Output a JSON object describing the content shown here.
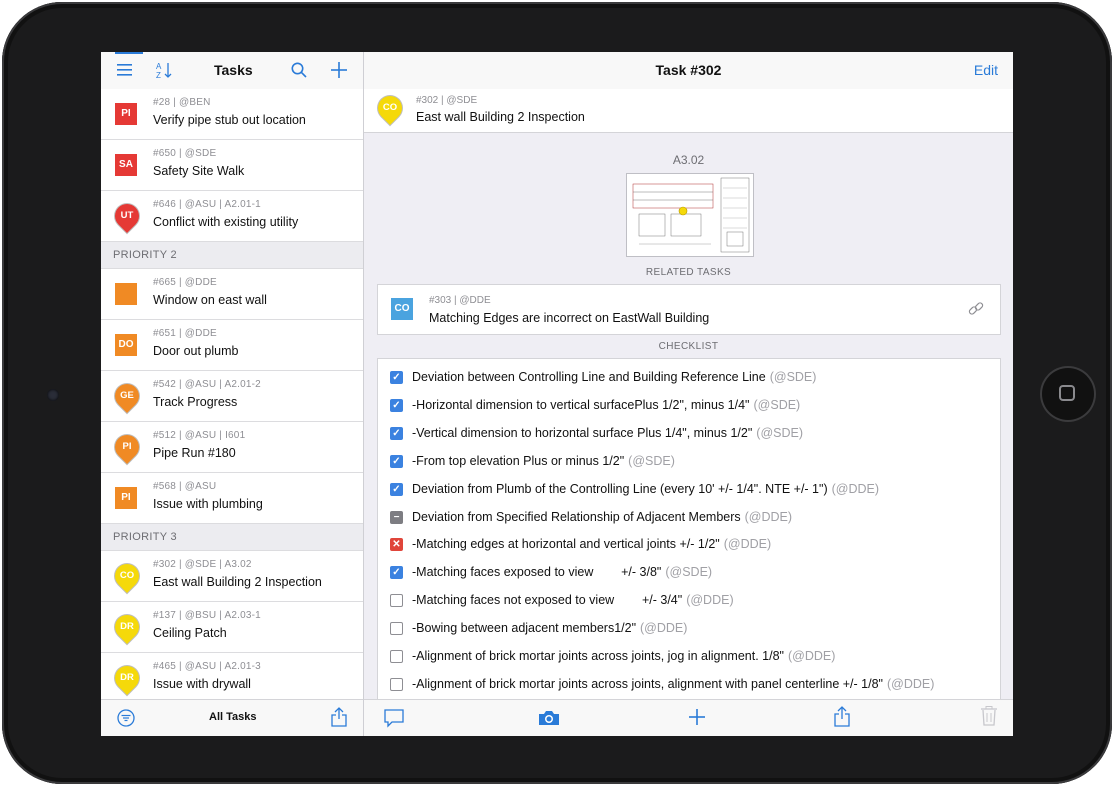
{
  "left_panel": {
    "title": "Tasks",
    "rows": [
      {
        "meta": "#28 | @BEN",
        "title": "Verify pipe stub out location",
        "code": "PI",
        "shape": "square",
        "color": "#e53935",
        "text_color": "#ffffff"
      },
      {
        "meta": "#650 | @SDE",
        "title": "Safety Site Walk",
        "code": "SA",
        "shape": "square",
        "color": "#e53935",
        "text_color": "#ffffff"
      },
      {
        "meta": "#646 | @ASU | A2.01-1",
        "title": "Conflict with existing utility",
        "code": "UT",
        "shape": "pin",
        "color": "#e53935",
        "text_color": "#ffffff"
      }
    ],
    "section_2": "PRIORITY 2",
    "rows_p2": [
      {
        "meta": "#665 | @DDE",
        "title": "Window on east wall",
        "code": "",
        "shape": "square",
        "color": "#f08a24",
        "text_color": "#ffffff"
      },
      {
        "meta": "#651 | @DDE",
        "title": "Door out plumb",
        "code": "DO",
        "shape": "square",
        "color": "#f08a24",
        "text_color": "#ffffff"
      },
      {
        "meta": "#542 | @ASU | A2.01-2",
        "title": "Track Progress",
        "code": "GE",
        "shape": "pin",
        "color": "#f08a24",
        "text_color": "#ffffff"
      },
      {
        "meta": "#512 | @ASU | I601",
        "title": "Pipe Run #180",
        "code": "PI",
        "shape": "pin",
        "color": "#f08a24",
        "text_color": "#ffffff"
      },
      {
        "meta": "#568 | @ASU",
        "title": "Issue with plumbing",
        "code": "PI",
        "shape": "square",
        "color": "#f08a24",
        "text_color": "#ffffff"
      }
    ],
    "section_3": "PRIORITY 3",
    "rows_p3": [
      {
        "meta": "#302 | @SDE | A3.02",
        "title": "East wall Building 2 Inspection",
        "code": "CO",
        "shape": "pin",
        "color": "#f5d90a",
        "text_color": "#ffffff"
      },
      {
        "meta": "#137 | @BSU | A2.03-1",
        "title": "Ceiling Patch",
        "code": "DR",
        "shape": "pin",
        "color": "#f5d90a",
        "text_color": "#ffffff"
      },
      {
        "meta": "#465 | @ASU | A2.01-3",
        "title": "Issue with drywall",
        "code": "DR",
        "shape": "pin",
        "color": "#f5d90a",
        "text_color": "#ffffff"
      }
    ],
    "bottom_label": "All Tasks"
  },
  "detail": {
    "title": "Task #302",
    "edit_label": "Edit",
    "task_code": "CO",
    "task_meta": "#302 | @SDE",
    "task_title": "East wall Building 2 Inspection",
    "sheet_label": "A3.02",
    "related_heading": "RELATED TASKS",
    "related": {
      "code": "CO",
      "meta": "#303 | @DDE",
      "title": "Matching Edges are incorrect on EastWall Building"
    },
    "checklist_heading": "CHECKLIST",
    "checklist": [
      {
        "text": "Deviation between Controlling Line and Building Reference Line",
        "user": "(@SDE)",
        "state": "checked"
      },
      {
        "text": "-Horizontal dimension to vertical surfacePlus 1/2\", minus 1/4\"",
        "user": "(@SDE)",
        "state": "checked"
      },
      {
        "text": "-Vertical dimension to horizontal surface Plus 1/4\", minus 1/2\"",
        "user": "(@SDE)",
        "state": "checked"
      },
      {
        "text": "-From top elevation Plus or minus 1/2\"",
        "user": "(@SDE)",
        "state": "checked"
      },
      {
        "text": "Deviation from Plumb of the Controlling Line (every 10' +/- 1/4\". NTE +/- 1\")",
        "user": "(@DDE)",
        "state": "checked"
      },
      {
        "text": "Deviation from Specified Relationship of Adjacent Members",
        "user": "(@DDE)",
        "state": "mixed"
      },
      {
        "text": "-Matching edges at horizontal and vertical joints +/- 1/2\"",
        "user": "(@DDE)",
        "state": "failed"
      },
      {
        "text": "-Matching faces exposed to view        +/- 3/8\"",
        "user": "(@SDE)",
        "state": "checked"
      },
      {
        "text": "-Matching faces not exposed to view        +/- 3/4\"",
        "user": "(@DDE)",
        "state": "empty"
      },
      {
        "text": "-Bowing between adjacent members1/2\"",
        "user": "(@DDE)",
        "state": "empty"
      },
      {
        "text": "-Alignment of brick mortar joints across joints, jog in alignment. 1/8\"",
        "user": "(@DDE)",
        "state": "empty"
      },
      {
        "text": "-Alignment of brick mortar joints across joints, alignment with panel centerline +/- 1/8\"",
        "user": "(@DDE)",
        "state": "empty"
      }
    ]
  },
  "colors": {
    "accent": "#2a7bd8",
    "priority1": "#e53935",
    "priority2": "#f08a24",
    "priority3": "#f5d90a",
    "related_code": "#4aa3df"
  }
}
